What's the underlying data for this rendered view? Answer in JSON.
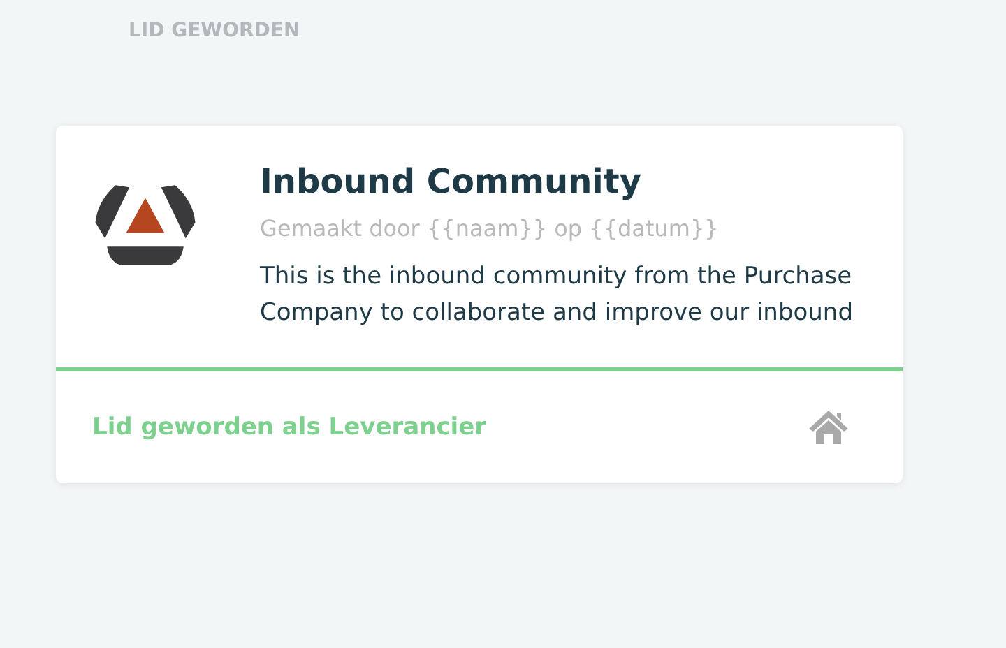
{
  "section_title": "LID GEWORDEN",
  "community": {
    "name": "Inbound Community",
    "meta": "Gemaakt door {{naam}} op {{datum}}",
    "description": "This is the inbound community from the Purchase Company to collaborate and improve our inbound",
    "membership": "Lid geworden als Leverancier"
  }
}
